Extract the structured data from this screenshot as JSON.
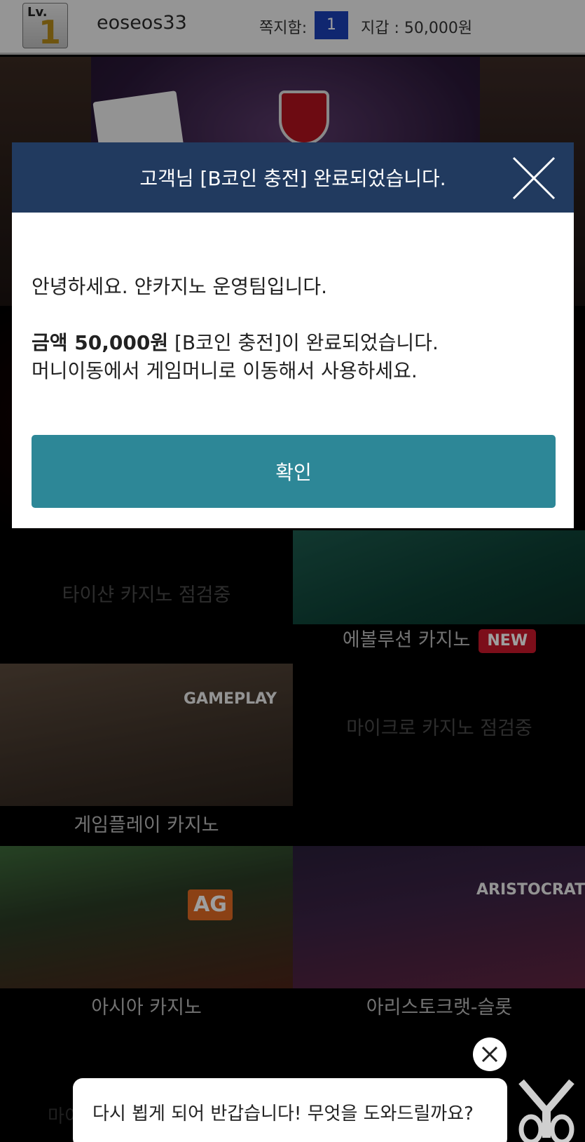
{
  "header": {
    "level_label": "Lv.",
    "level_value": "1",
    "username": "eoseos33",
    "messages_label": "쪽지함:",
    "messages_count": "1",
    "wallet": "지갑 : 50,000원"
  },
  "games": [
    {
      "caption": "타이샨 카지노 점검중",
      "status": "maintenance"
    },
    {
      "caption": "에볼루션 카지노",
      "badge": "NEW"
    },
    {
      "caption": "게임플레이 카지노",
      "brand": "GAMEPLAY"
    },
    {
      "caption": "마이크로 카지노 점검중",
      "status": "maintenance"
    },
    {
      "caption": "아시아 카지노",
      "brand": "AG"
    },
    {
      "caption": "아리스토크랫-슬롯",
      "brand": "ARISTOCRAT"
    }
  ],
  "partial_caption": "마이",
  "modal": {
    "title": "고객님 [B코인 충전] 완료되었습니다.",
    "greeting": "안녕하세요. 얀카지노 운영팀입니다.",
    "amount_strong": "금액 50,000원",
    "amount_rest": " [B코인 충전]이 완료되었습니다.",
    "instruction": "머니이동에서 게임머니로 이동해서 사용하세요.",
    "confirm_label": "확인"
  },
  "chat": {
    "message": "다시 뵙게 되어 반갑습니다! 무엇을 도와드릴까요?"
  },
  "colors": {
    "modal_header": "#213a5f",
    "confirm_button": "#2d8797",
    "message_badge": "#1b3fb5",
    "new_badge": "#c8182b"
  }
}
